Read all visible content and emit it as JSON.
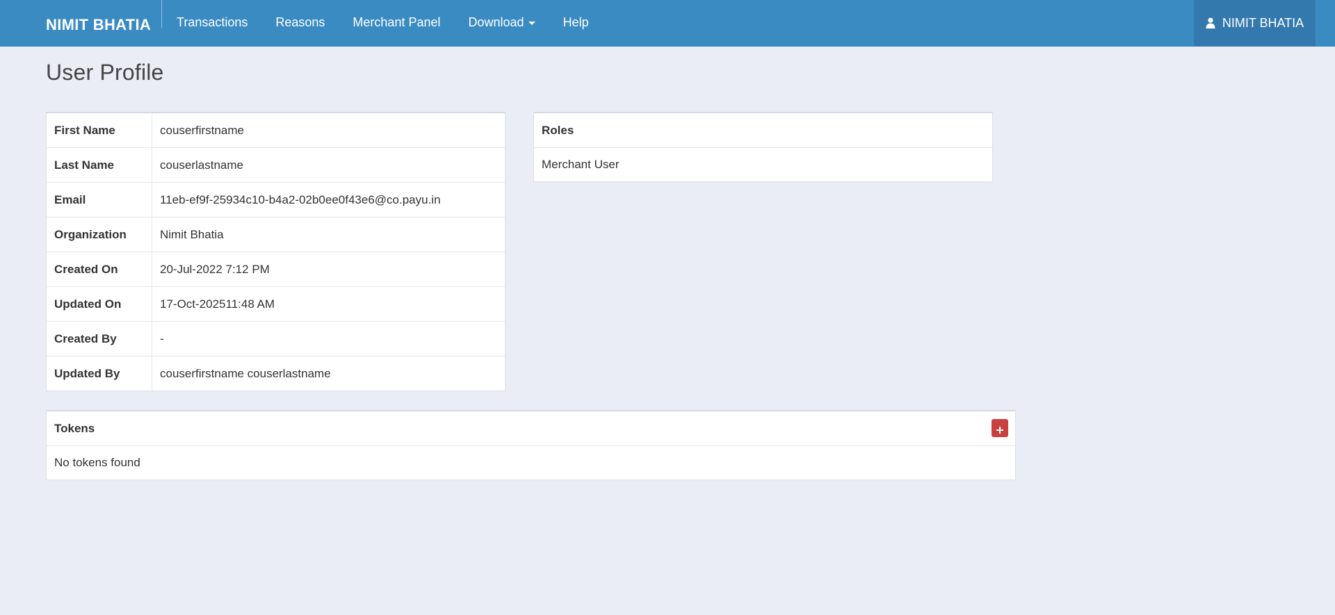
{
  "navbar": {
    "brand": "NIMIT BHATIA",
    "links": {
      "transactions": "Transactions",
      "reasons": "Reasons",
      "merchant_panel": "Merchant Panel",
      "download": "Download",
      "help": "Help"
    },
    "user_label": "NIMIT BHATIA",
    "icons": {
      "user": "user-icon",
      "download_caret": "caret-down-icon"
    }
  },
  "page": {
    "title": "User Profile"
  },
  "profile": {
    "rows": [
      {
        "label": "First Name",
        "value": "couserfirstname"
      },
      {
        "label": "Last Name",
        "value": "couserlastname"
      },
      {
        "label": "Email",
        "value": "11eb-ef9f-25934c10-b4a2-02b0ee0f43e6@co.payu.in"
      },
      {
        "label": "Organization",
        "value": "Nimit Bhatia"
      },
      {
        "label": "Created On",
        "value": "20-Jul-2022 7:12 PM"
      },
      {
        "label": "Updated On",
        "value": "17-Oct-202511:48 AM"
      },
      {
        "label": "Created By",
        "value": "-"
      },
      {
        "label": "Updated By",
        "value": "couserfirstname couserlastname"
      }
    ]
  },
  "roles": {
    "header": "Roles",
    "items": [
      "Merchant User"
    ]
  },
  "tokens": {
    "header": "Tokens",
    "empty_text": "No tokens found",
    "add_button_icon": "plus-icon"
  },
  "colors": {
    "navbar": "#3b8bc3",
    "user_menu": "#3479ad",
    "page_bg": "#eaedf5",
    "add_button": "#c9403f"
  }
}
